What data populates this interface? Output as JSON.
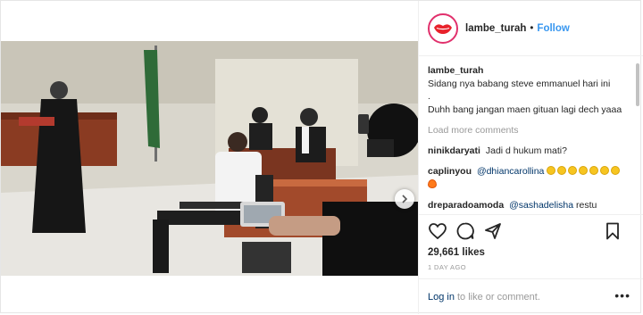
{
  "post": {
    "username": "lambe_turah",
    "separator": "•",
    "follow_label": "Follow",
    "caption": {
      "username": "lambe_turah",
      "lines": [
        "Sidang nya babang steve emmanuel hari ini",
        ".",
        "Duhh bang jangan maen gituan lagi dech yaaa"
      ]
    },
    "load_more_label": "Load more comments",
    "comments": [
      {
        "username": "ninikdaryati",
        "text": "Jadi d hukum mati?"
      },
      {
        "username": "caplinyou",
        "mention": "@dhiancarollina",
        "emojis": [
          "grin-emoji",
          "grin-emoji",
          "grin-emoji",
          "grin-emoji",
          "grin-emoji",
          "grin-emoji",
          "grin-emoji",
          "fire-emoji"
        ]
      },
      {
        "username": "dreparadoamoda",
        "mention": "@sashadelisha",
        "text": "restu"
      }
    ],
    "likes_label": "29,661 likes",
    "time_ago": "1 DAY AGO",
    "footer": {
      "login_label": "Log in",
      "suffix": "to like or comment.",
      "more_label": "•••"
    }
  },
  "icons": {
    "avatar": "lips-logo-icon",
    "next": "chevron-right-icon",
    "like": "heart-icon",
    "comment": "comment-bubble-icon",
    "share": "share-arrow-icon",
    "save": "bookmark-icon"
  },
  "colors": {
    "link": "#3897f0",
    "mention": "#003569",
    "muted": "#999999",
    "avatar_ring": "#e1306c",
    "logo_red": "#e8222b"
  }
}
